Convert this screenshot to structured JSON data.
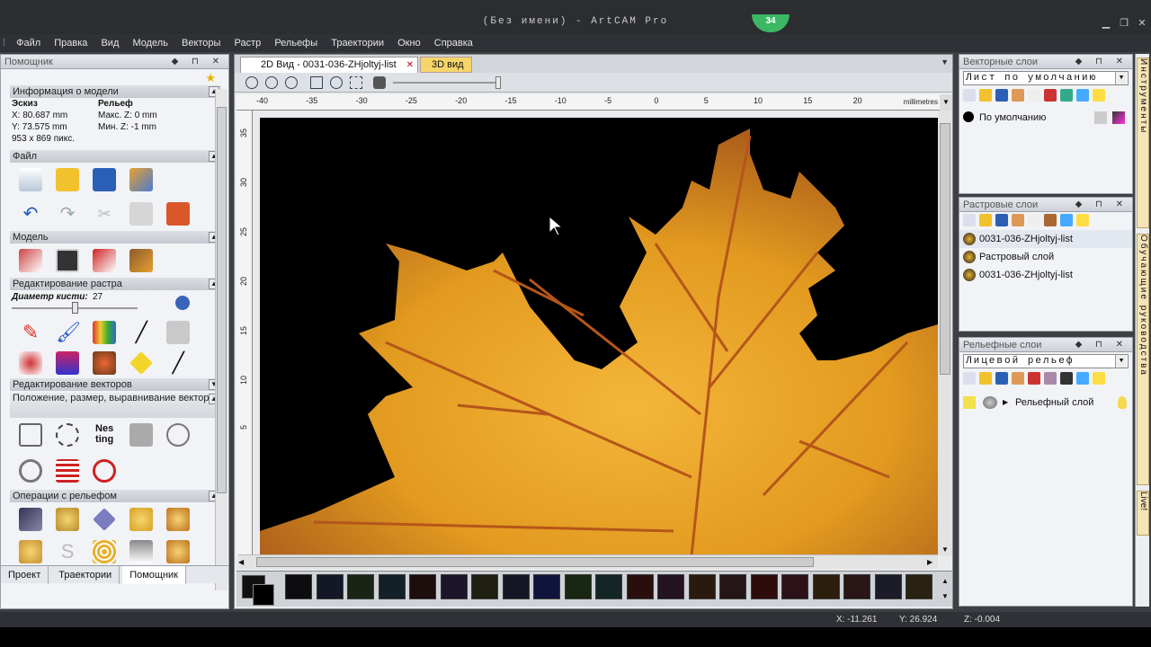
{
  "window": {
    "title": "(Без имени) - ArtCAM Pro",
    "badge": "34",
    "min_btn": "▁",
    "max_btn": "❐",
    "close_btn": "✕"
  },
  "menu": [
    "Файл",
    "Правка",
    "Вид",
    "Модель",
    "Векторы",
    "Растр",
    "Рельефы",
    "Траектории",
    "Окно",
    "Справка"
  ],
  "assistant": {
    "title": "Помощник",
    "model_info": {
      "heading": "Информация о модели",
      "sketch_label": "Эскиз",
      "relief_label": "Рельеф",
      "x": "X: 80.687 mm",
      "y": "Y: 73.575 mm",
      "pixels": "953 x 869 пикс.",
      "max_z": "Макс. Z: 0 mm",
      "min_z": "Мин. Z: -1 mm"
    },
    "sections": {
      "file": "Файл",
      "model": "Модель",
      "raster_edit": "Редактирование растра",
      "vector_edit": "Редактирование векторов",
      "vector_position": "Положение, размер, выравнивание векторов",
      "relief_ops": "Операции с рельефом"
    },
    "brush_label": "Диаметр кисти:",
    "brush_value": "27",
    "brush_level": 0.5,
    "tabs": [
      "Проект",
      "Траектории",
      "Помощник"
    ]
  },
  "doc_tabs": {
    "tab1": "2D Вид - 0031-036-ZHjoltyj-list",
    "tab2": "3D вид",
    "close": "✕"
  },
  "ruler": {
    "units": "millimetres",
    "top_ticks": [
      "-40",
      "-35",
      "-30",
      "-25",
      "-20",
      "-15",
      "-10",
      "-5",
      "0",
      "5",
      "10",
      "15",
      "20"
    ],
    "left_ticks": [
      "35",
      "30",
      "25",
      "20",
      "15",
      "10",
      "5"
    ]
  },
  "colors": {
    "leaf": "#e7a424",
    "vein": "#b5561a",
    "canvas_bg": "#000000",
    "accent_badge": "#3cb764"
  },
  "swatches": [
    "#0d0d10",
    "#141726",
    "#1a2416",
    "#132028",
    "#1e0d0d",
    "#1c1428",
    "#1f1f12",
    "#151525",
    "#11143a",
    "#182612",
    "#142525",
    "#2a0e0e",
    "#231222",
    "#2a1a0e",
    "#241616",
    "#2e0c0c",
    "#2c1218",
    "#2c1e0c",
    "#2a1616",
    "#1c1c28",
    "#2a2210"
  ],
  "vector_layers": {
    "title": "Векторные слои",
    "combo": "Лист по умолчанию",
    "items": [
      "По умолчанию"
    ]
  },
  "raster_layers": {
    "title": "Растровые слои",
    "items": [
      "0031-036-ZHjoltyj-list",
      "Растровый слой",
      "0031-036-ZHjoltyj-list"
    ]
  },
  "relief_layers": {
    "title": "Рельефные слои",
    "combo": "Лицевой рельеф",
    "items": [
      "Рельефный слой"
    ]
  },
  "side_tabs": [
    "Инструменты",
    "Обучающие руководства",
    "Live!"
  ],
  "status": {
    "x": "X: -11.261",
    "y": "Y: 26.924",
    "z": "Z: -0.004"
  }
}
